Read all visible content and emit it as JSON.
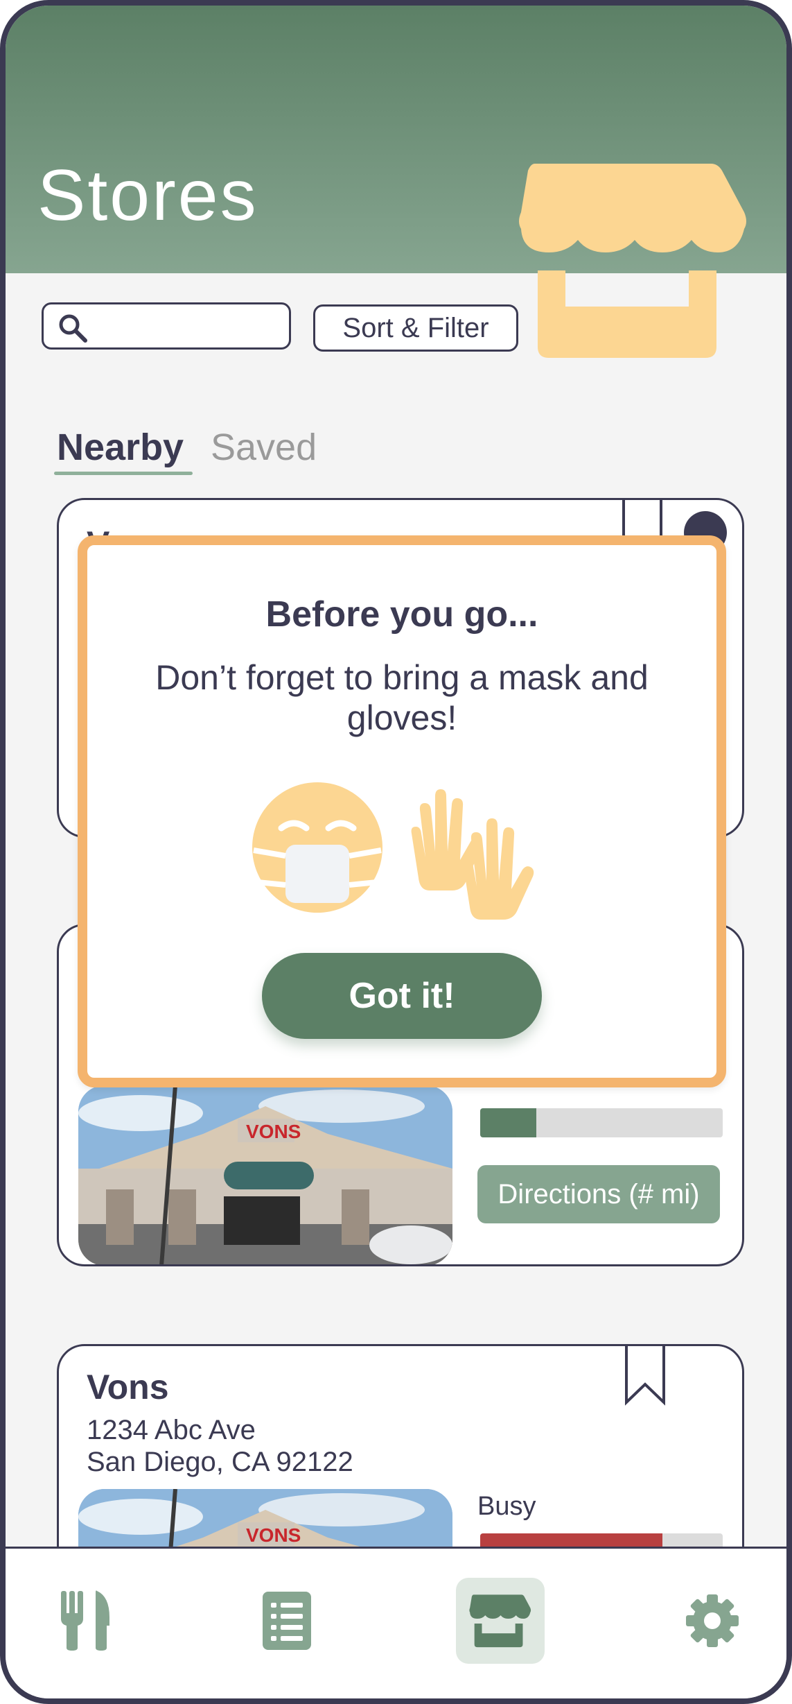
{
  "header": {
    "title": "Stores",
    "hero_icon": "storefront-icon",
    "hero_color": "#fcd692"
  },
  "search": {
    "value": "",
    "placeholder": "",
    "icon": "search-icon"
  },
  "sort_filter": {
    "label": "Sort & Filter"
  },
  "tabs": [
    {
      "label": "Nearby",
      "active": true
    },
    {
      "label": "Saved",
      "active": false
    }
  ],
  "stores": [
    {
      "name": "Vons",
      "address_line1": "",
      "address_line2": "",
      "busy_label": "",
      "busy_level": 0.0,
      "busy_color": "#5c8066",
      "directions_label": "",
      "saved": false
    },
    {
      "name": "",
      "address_line1": "",
      "address_line2": "",
      "busy_label": "",
      "busy_level": 0.23,
      "busy_color": "#5c8066",
      "directions_label": "Directions (# mi)",
      "saved": false
    },
    {
      "name": "Vons",
      "address_line1": "1234 Abc Ave",
      "address_line2": "San Diego, CA 92122",
      "busy_label": "Busy",
      "busy_level": 0.75,
      "busy_color": "#b84040",
      "directions_label": "",
      "saved": false
    }
  ],
  "modal": {
    "title": "Before you go...",
    "message": "Don’t forget to bring a mask and gloves!",
    "button_label": "Got it!",
    "border_color": "#f4b46e",
    "icons": [
      "face-mask-icon",
      "gloves-icon"
    ]
  },
  "bottom_nav": [
    {
      "name": "meals",
      "icon": "fork-knife-icon",
      "active": false
    },
    {
      "name": "list",
      "icon": "list-icon",
      "active": false
    },
    {
      "name": "stores",
      "icon": "storefront-icon",
      "active": true
    },
    {
      "name": "settings",
      "icon": "gear-icon",
      "active": false
    }
  ],
  "colors": {
    "primary": "#5c8066",
    "secondary": "#86a590",
    "accent": "#fcd692",
    "text": "#3b3a52"
  }
}
